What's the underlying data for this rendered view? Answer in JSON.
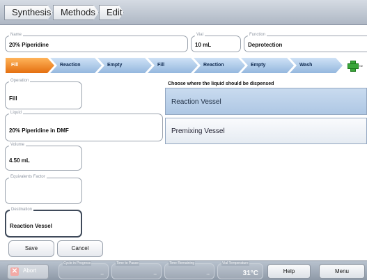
{
  "breadcrumbs": [
    "Synthesis",
    "Methods",
    "Edit"
  ],
  "header": {
    "name": {
      "label": "Name",
      "value": "20% Piperidine"
    },
    "vial": {
      "label": "Vial",
      "value": "10 mL"
    },
    "function": {
      "label": "Function",
      "value": "Deprotection"
    }
  },
  "steps": [
    "Fill",
    "Reaction",
    "Empty",
    "Fill",
    "Reaction",
    "Empty",
    "Wash"
  ],
  "active_step_index": 0,
  "add_step_label": "Ne",
  "left_fields": {
    "operation": {
      "label": "Operation",
      "value": "Fill"
    },
    "liquid": {
      "label": "Liquid",
      "value": "20% Piperidine in DMF"
    },
    "volume": {
      "label": "Volume",
      "value": "4.50 mL"
    },
    "equivalents": {
      "label": "Equivalents Factor",
      "value": ""
    },
    "destination": {
      "label": "Destination",
      "value": "Reaction Vessel"
    }
  },
  "prompt": "Choose where the liquid should be dispensed",
  "choices": [
    "Reaction Vessel",
    "Premixing Vessel"
  ],
  "selected_choice": "Reaction Vessel",
  "actions": {
    "save": "Save",
    "cancel": "Cancel"
  },
  "status_bar": {
    "abort": "Abort",
    "cycle": {
      "label": "Cycle in Progress",
      "value": "--"
    },
    "pause": {
      "label": "Time to Pause",
      "value": "--"
    },
    "remaining": {
      "label": "Time Remaining",
      "value": "--"
    },
    "temperature": {
      "label": "Vial Temperature",
      "value": "31°C"
    },
    "help": "Help",
    "menu": "Menu"
  },
  "colors": {
    "active_step": "#ef8420",
    "step": "#a9c6e6",
    "selected_choice": "#bcd1ea"
  }
}
